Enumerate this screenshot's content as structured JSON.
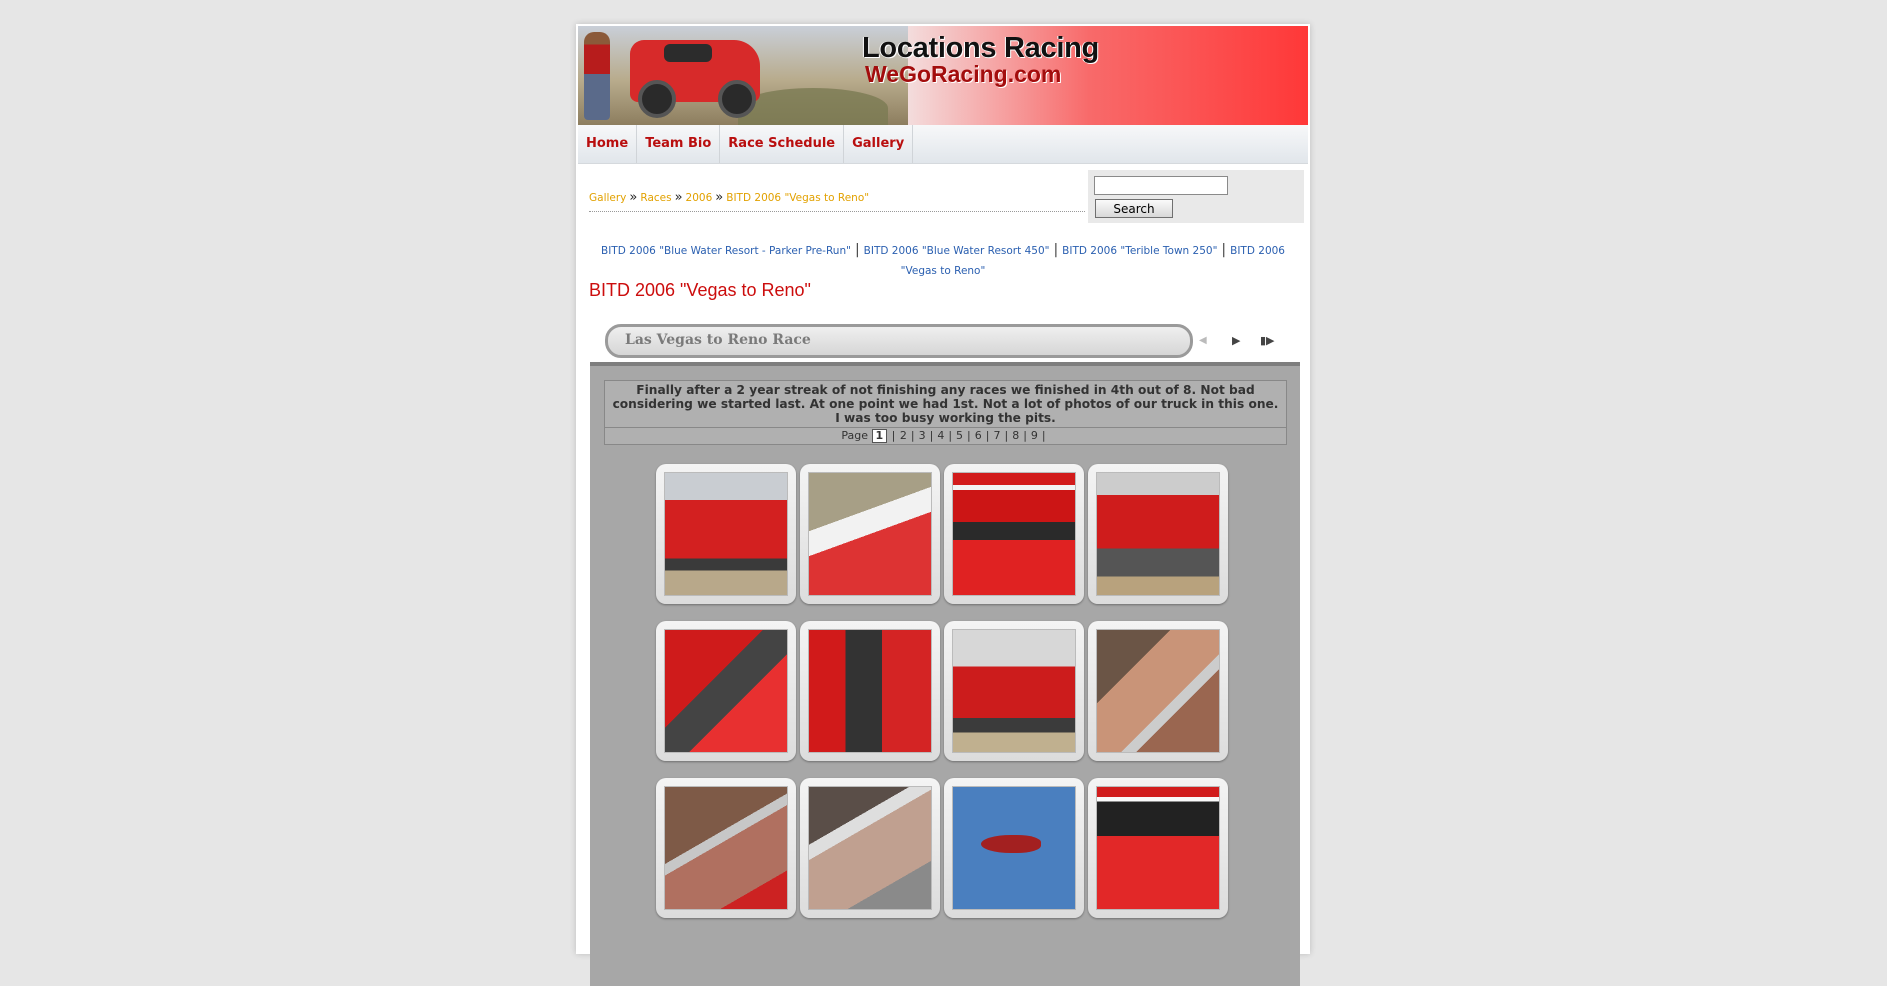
{
  "banner": {
    "title": "Locations Racing",
    "subtitle": "WeGoRacing.com"
  },
  "nav": {
    "items": [
      "Home",
      "Team Bio",
      "Race Schedule",
      "Gallery"
    ]
  },
  "breadcrumb": [
    "Gallery",
    "Races",
    "2006",
    "BITD 2006 \"Vegas to Reno\""
  ],
  "breadcrumb_separator": "»",
  "search": {
    "value": "",
    "button_label": "Search"
  },
  "race_links": [
    "BITD 2006 \"Blue Water Resort - Parker Pre-Run\"",
    "BITD 2006 \"Blue Water Resort 450\"",
    "BITD 2006 \"Terible Town 250\"",
    "BITD 2006 \"Vegas to Reno\""
  ],
  "race_link_separator": "|",
  "page_title": "BITD 2006 \"Vegas to Reno\"",
  "album": {
    "title": "Las Vegas to Reno Race",
    "controls": {
      "prev_icon": "◀",
      "next_icon": "▶",
      "slideshow_icon": "▮▶"
    },
    "description": "Finally after a 2 year streak of not finishing any races we finished in 4th out of 8. Not bad considering we started last. At one point we had 1st. Not a lot of photos of our truck in this one. I was too busy working the pits.",
    "pager": {
      "label": "Page",
      "current": "1",
      "pages": [
        "2",
        "3",
        "4",
        "5",
        "6",
        "7",
        "8",
        "9"
      ],
      "separator": "|"
    }
  },
  "thumbnails": [
    "truck-and-crew",
    "man-in-cap",
    "truck-front",
    "truck-front-2",
    "driver-in-cab",
    "truck-door-open",
    "truck-pits",
    "driver-portrait",
    "driver-closeup",
    "driver-closeup-2",
    "helicopter",
    "truck-hood"
  ]
}
